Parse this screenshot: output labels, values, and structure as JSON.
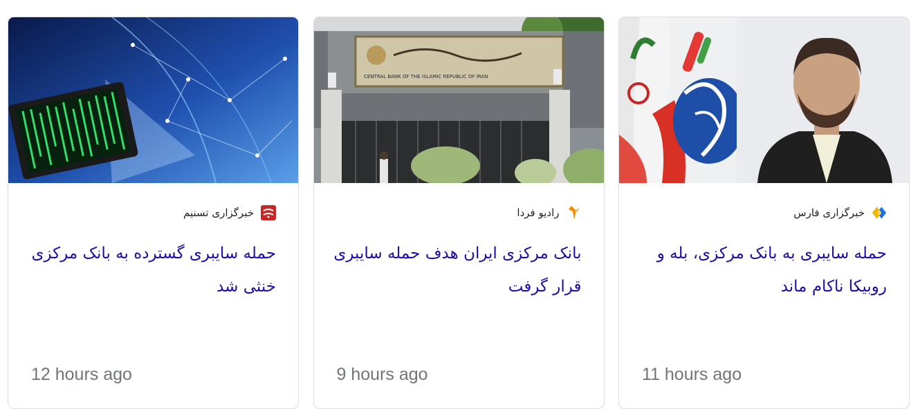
{
  "cards": [
    {
      "source": "خبرگزاری فارس",
      "source_logo": "fars-logo-icon",
      "headline": "حمله سایبری به بانک مرکزی، بله و روبیکا ناکام ماند",
      "age": "11 hours ago",
      "thumbnail": "official-portrait-image",
      "colors": {
        "logo_primary": "#f5b400",
        "logo_secondary": "#1a73e8"
      }
    },
    {
      "source": "رادیو فردا",
      "source_logo": "radio-farda-logo-icon",
      "headline": "بانک مرکزی ایران هدف حمله سایبری قرار گرفت",
      "age": "9 hours ago",
      "thumbnail": "central-bank-building-image",
      "colors": {
        "logo_primary": "#f28b00"
      }
    },
    {
      "source": "خبرگزاری تسنیم",
      "source_logo": "tasnim-logo-icon",
      "headline": "حمله سایبری گسترده به بانک مرکزی خنثی شد",
      "age": "12 hours ago",
      "thumbnail": "cyber-attack-laptop-image",
      "colors": {
        "logo_primary": "#c62828"
      }
    }
  ],
  "thumbnail_text": {
    "bank_sign": "CENTRAL BANK OF THE ISLAMIC REPUBLIC OF IRAN"
  }
}
